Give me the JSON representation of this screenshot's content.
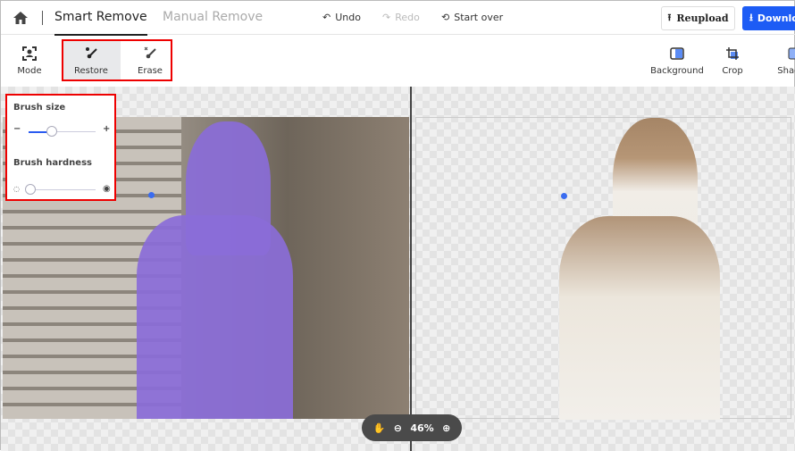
{
  "header": {
    "tabs": [
      {
        "label": "Smart Remove",
        "active": true
      },
      {
        "label": "Manual Remove",
        "active": false
      }
    ],
    "undo": "Undo",
    "redo": "Redo",
    "start_over": "Start over",
    "reupload": "Reupload",
    "download": "Download"
  },
  "toolbar": {
    "mode": "Mode",
    "restore": "Restore",
    "erase": "Erase",
    "background": "Background",
    "crop": "Crop",
    "shadow": "Shadow"
  },
  "brush_panel": {
    "size_label": "Brush size",
    "size_value_percent": 33,
    "hardness_label": "Brush hardness",
    "hardness_value_percent": 0
  },
  "zoom": {
    "level": "46%"
  },
  "colors": {
    "accent": "#1d5cf5",
    "highlight": "#e00000",
    "restore_mask": "#8a6cd8"
  }
}
